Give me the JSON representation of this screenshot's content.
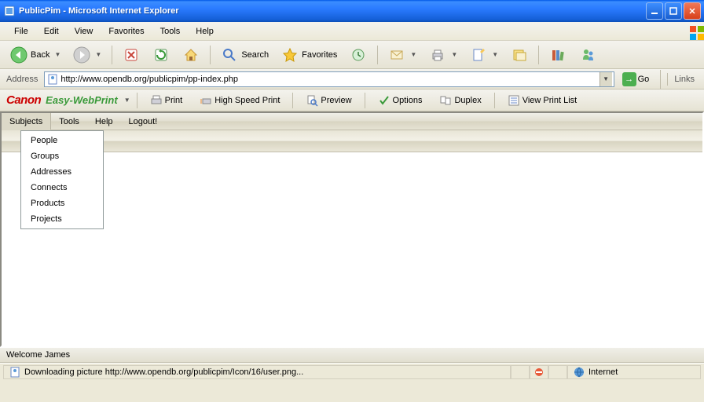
{
  "window": {
    "title": "PublicPim - Microsoft Internet Explorer"
  },
  "ie_menu": {
    "file": "File",
    "edit": "Edit",
    "view": "View",
    "favorites": "Favorites",
    "tools": "Tools",
    "help": "Help"
  },
  "ie_toolbar": {
    "back": "Back",
    "search": "Search",
    "favorites": "Favorites"
  },
  "address": {
    "label": "Address",
    "url": "http://www.opendb.org/publicpim/pp-index.php",
    "go": "Go",
    "links": "Links"
  },
  "canon": {
    "brand": "Canon",
    "product": "Easy-WebPrint",
    "print": "Print",
    "highspeed": "High Speed Print",
    "preview": "Preview",
    "options": "Options",
    "duplex": "Duplex",
    "viewlist": "View Print List"
  },
  "page_menu": {
    "subjects": "Subjects",
    "tools": "Tools",
    "help": "Help",
    "logout": "Logout!"
  },
  "subjects_menu": {
    "items": [
      "People",
      "Groups",
      "Addresses",
      "Connects",
      "Products",
      "Projects"
    ]
  },
  "welcome": "Welcome James",
  "status": {
    "text": "Downloading picture http://www.opendb.org/publicpim/Icon/16/user.png...",
    "zone": "Internet"
  }
}
